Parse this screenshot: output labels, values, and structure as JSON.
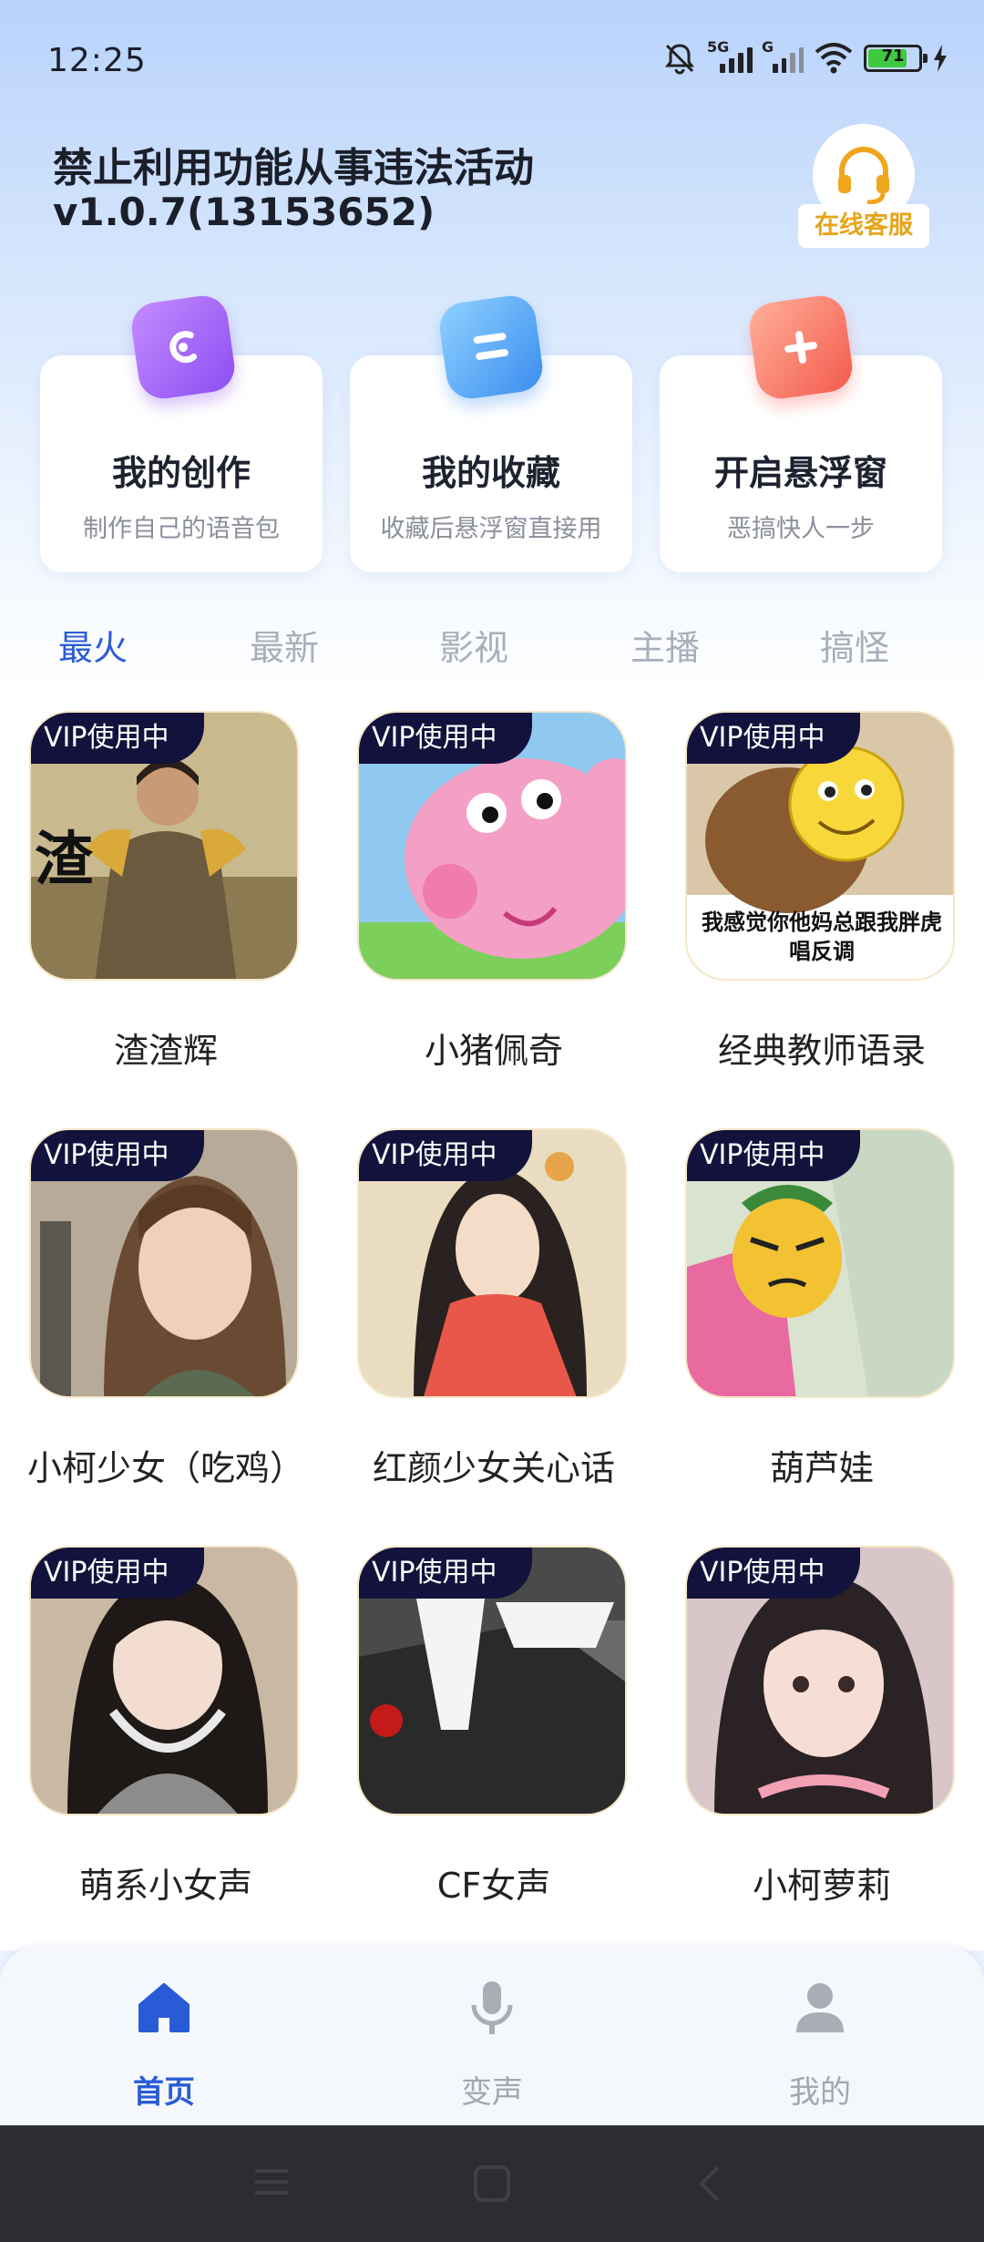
{
  "status": {
    "time": "12:25",
    "sig1": "5G",
    "sig2": "G",
    "battery": "71"
  },
  "header": {
    "warning": "禁止利用功能从事违法活动",
    "version": "v1.0.7(13153652)",
    "service_label": "在线客服"
  },
  "cards": [
    {
      "title": "我的创作",
      "subtitle": "制作自己的语音包"
    },
    {
      "title": "我的收藏",
      "subtitle": "收藏后悬浮窗直接用"
    },
    {
      "title": "开启悬浮窗",
      "subtitle": "恶搞快人一步"
    }
  ],
  "tabs": [
    "最火",
    "最新",
    "影视",
    "主播",
    "搞怪"
  ],
  "vip_badge": "VIP使用中",
  "items": [
    {
      "name": "渣渣辉",
      "thumb_text": "渣"
    },
    {
      "name": "小猪佩奇"
    },
    {
      "name": "经典教师语录",
      "thumb_text": "我感觉你他妈总跟我胖虎唱反调"
    },
    {
      "name": "小柯少女（吃鸡）"
    },
    {
      "name": "红颜少女关心话"
    },
    {
      "name": "葫芦娃"
    },
    {
      "name": "萌系小女声"
    },
    {
      "name": "CF女声"
    },
    {
      "name": "小柯萝莉"
    }
  ],
  "nav": [
    "首页",
    "变声",
    "我的"
  ],
  "colors": {
    "accent": "#2a5bd7",
    "vip_bg": "#13123c",
    "service": "#e6a418"
  }
}
